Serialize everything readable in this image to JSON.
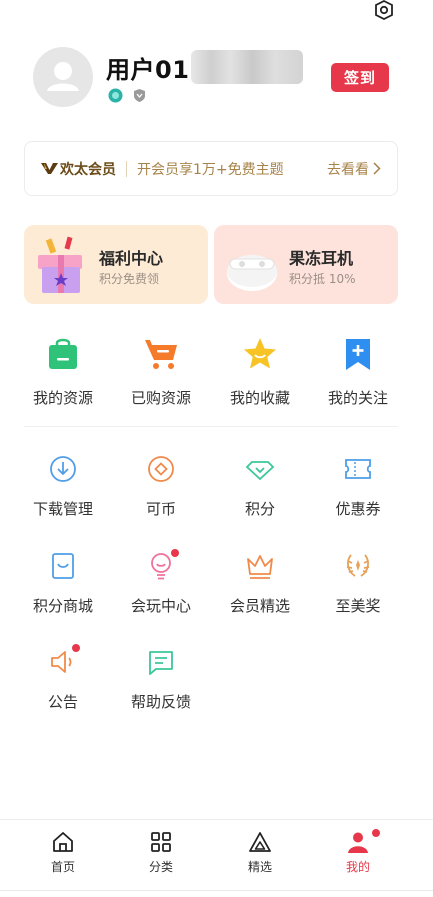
{
  "profile": {
    "username": "用户01",
    "checkin_label": "签到"
  },
  "vip": {
    "name": "欢太会员",
    "promo": "开会员享1万+免费主题",
    "cta": "去看看"
  },
  "cards": [
    {
      "title": "福利中心",
      "subtitle": "积分免费领"
    },
    {
      "title": "果冻耳机",
      "subtitle": "积分抵 10%"
    }
  ],
  "primary_grid": [
    {
      "label": "我的资源",
      "icon": "shopping-bag-icon",
      "color": "#2fc37a"
    },
    {
      "label": "已购资源",
      "icon": "cart-icon",
      "color": "#f57a2a"
    },
    {
      "label": "我的收藏",
      "icon": "star-icon",
      "color": "#f7c325"
    },
    {
      "label": "我的关注",
      "icon": "bookmark-plus-icon",
      "color": "#2f8ff0"
    }
  ],
  "secondary_grid": [
    {
      "label": "下载管理",
      "icon": "download-icon"
    },
    {
      "label": "可币",
      "icon": "coin-icon"
    },
    {
      "label": "积分",
      "icon": "diamond-icon"
    },
    {
      "label": "优惠券",
      "icon": "ticket-icon"
    },
    {
      "label": "积分商城",
      "icon": "mall-icon"
    },
    {
      "label": "会玩中心",
      "icon": "bulb-icon"
    },
    {
      "label": "会员精选",
      "icon": "crown-icon"
    },
    {
      "label": "至美奖",
      "icon": "laurel-icon"
    },
    {
      "label": "公告",
      "icon": "speaker-icon"
    },
    {
      "label": "帮助反馈",
      "icon": "message-icon"
    }
  ],
  "tabs": [
    {
      "label": "首页",
      "icon": "home-icon"
    },
    {
      "label": "分类",
      "icon": "grid-icon"
    },
    {
      "label": "精选",
      "icon": "triangle-icon"
    },
    {
      "label": "我的",
      "icon": "person-icon",
      "active": true
    }
  ],
  "colors": {
    "accent": "#e6384a",
    "vip_gold": "#a7834a"
  }
}
